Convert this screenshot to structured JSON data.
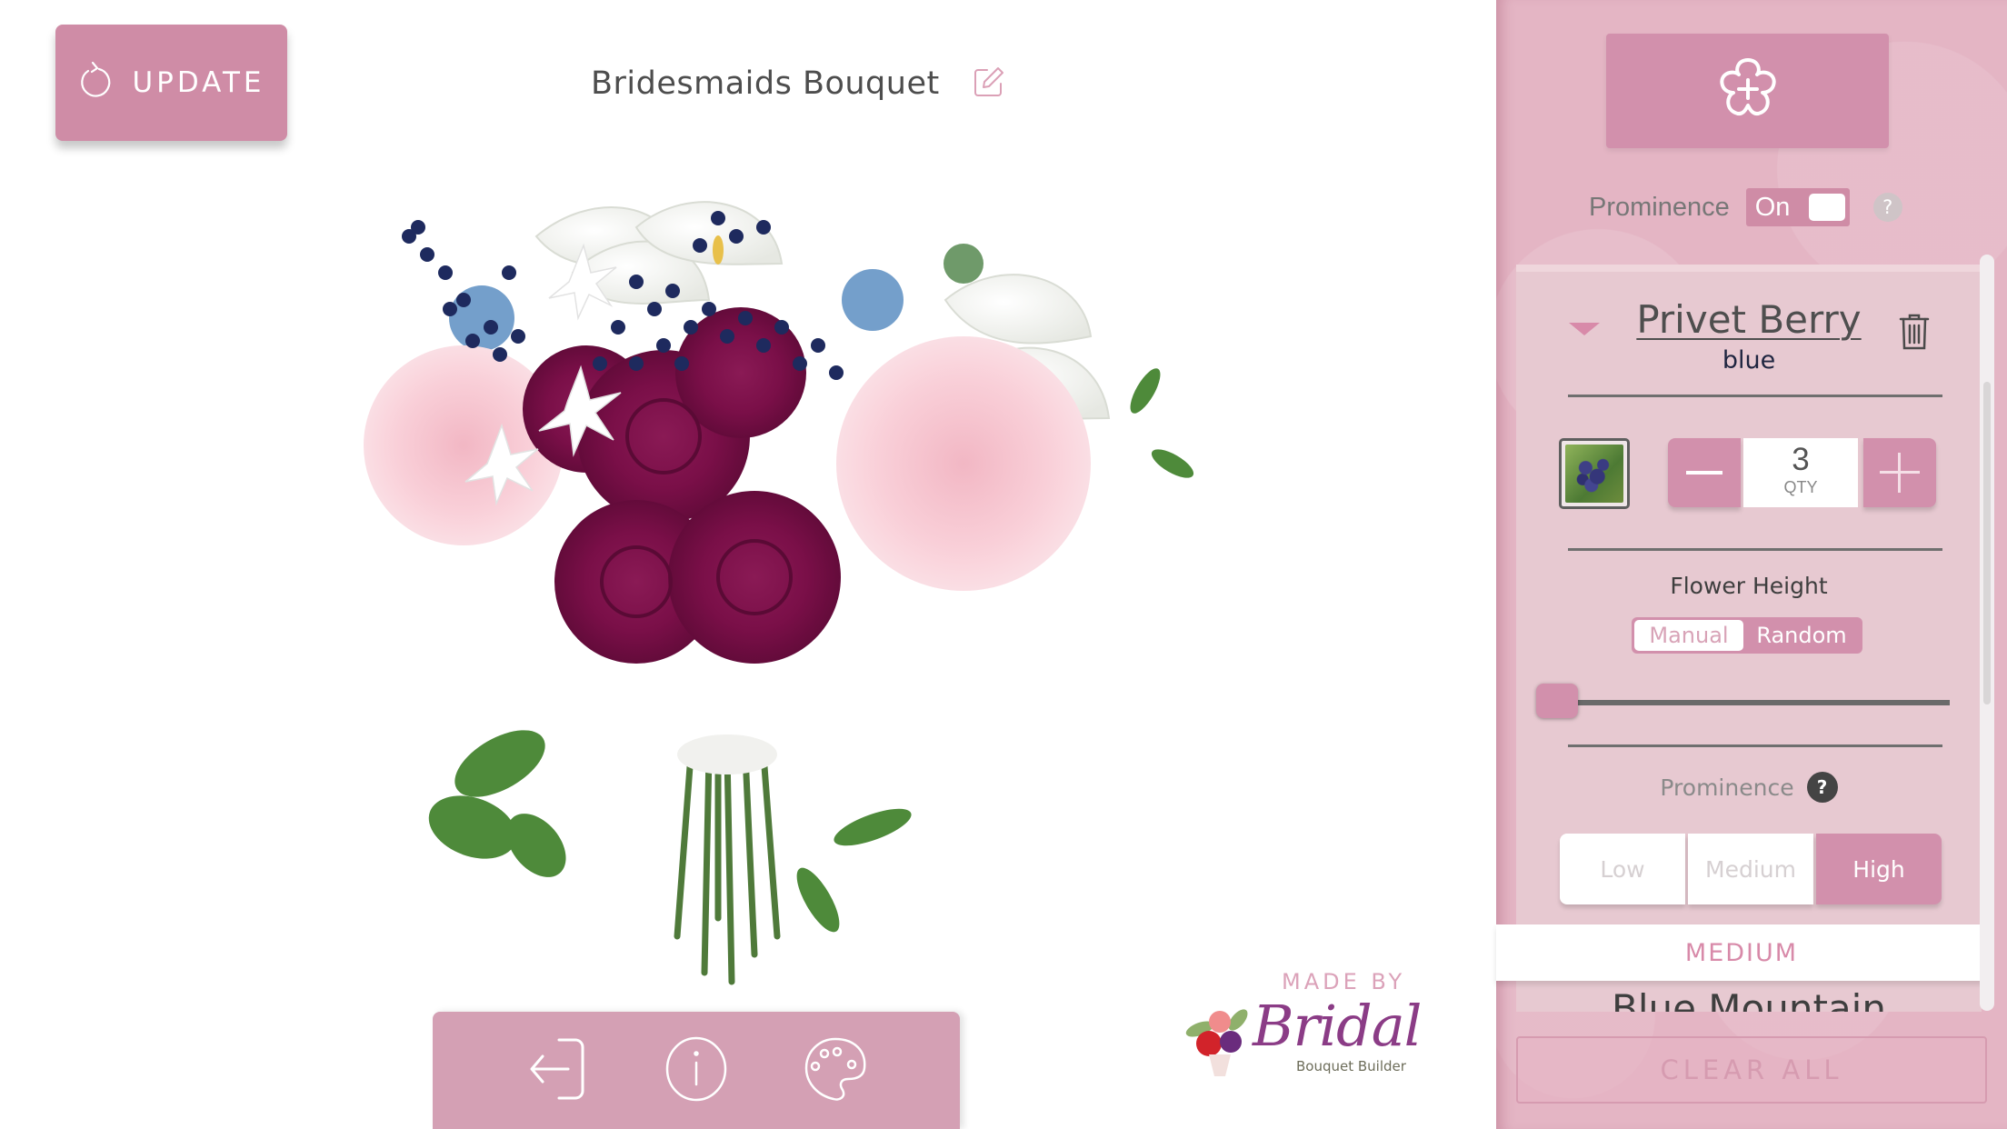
{
  "header": {
    "update_label": "UPDATE",
    "update_icon": "refresh-icon",
    "bouquet_title": "Bridesmaids Bouquet",
    "edit_icon": "pencil-edit-icon"
  },
  "canvas": {
    "description": "3D bouquet preview",
    "flowers_visible": [
      "pink garden rose",
      "burgundy rose",
      "white calla lily",
      "blue privet berry",
      "blue thistle",
      "white stephanotis",
      "greenery"
    ]
  },
  "toolbar": {
    "items": [
      {
        "name": "exit",
        "icon": "exit-arrow-icon"
      },
      {
        "name": "info",
        "icon": "info-icon"
      },
      {
        "name": "palette",
        "icon": "palette-icon"
      }
    ]
  },
  "branding": {
    "made_by": "MADE BY",
    "logo_name": "Bridal",
    "logo_sub": "Bouquet Builder"
  },
  "panel": {
    "add_flower_icon": "flower-plus-icon",
    "prominence_label": "Prominence",
    "prominence_toggle": "On",
    "help_symbol": "?",
    "card": {
      "flower_name": "Privet Berry",
      "flower_color": "blue",
      "quantity": "3",
      "quantity_label": "QTY",
      "minus_symbol": "−",
      "plus_symbol": "+",
      "flower_height_label": "Flower Height",
      "height_modes": [
        "Manual",
        "Random"
      ],
      "height_mode_selected": "Manual",
      "height_slider_value": 0,
      "prominence_label": "Prominence",
      "prominence_levels": [
        "Low",
        "Medium",
        "High"
      ],
      "prominence_selected": "High"
    },
    "group_header": "MEDIUM",
    "next_flower_name": "Blue Mountain",
    "clear_all_label": "CLEAR ALL"
  },
  "colors": {
    "accent": "#cf8ca6",
    "panel_bg": "#e4b5c4",
    "card_bg": "#e7c9d1",
    "text_dark": "#4d4d4d"
  }
}
